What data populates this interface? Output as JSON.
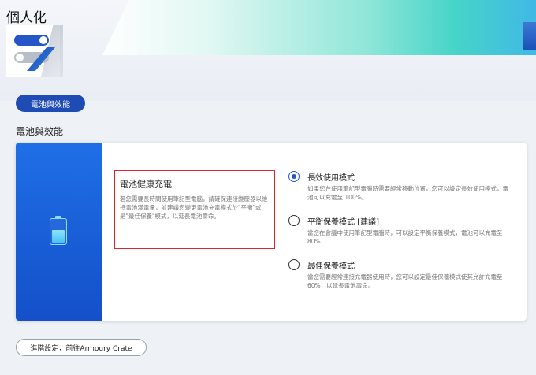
{
  "page": {
    "title": "個人化"
  },
  "hero": {
    "chip_label": "電池與效能"
  },
  "section": {
    "title": "電池與效能"
  },
  "card": {
    "info": {
      "title": "電池健康充電",
      "body": "若您需要長時間使用筆記型電腦，請確保連接變壓器以維持電池滿電量，並建議您變更電池充電模式於\"平衡\"或是\"最佳保養\"模式，以延長電池壽命。"
    },
    "options": [
      {
        "title": "長效使用模式",
        "desc": "如果您在使用筆記型電腦時需要經常移動位置，您可以設定長效使用模式，電池可以充電至 100%。",
        "checked": true
      },
      {
        "title": "平衡保養模式 [建議]",
        "desc": "當您在會議中使用筆記型電腦時，可以設定平衡保養模式，電池可以充電至 80%",
        "checked": false
      },
      {
        "title": "最佳保養模式",
        "desc": "當您需要經常連接充電器使用時，您可以設定最佳保養模式使其允許充電至60%，以延長電池壽命。",
        "checked": false
      }
    ]
  },
  "footer": {
    "button_label": "進階設定，前往Armoury Crate"
  },
  "colors": {
    "accent": "#2456c8",
    "highlight_border": "#d8262c",
    "side_panel": "#1f6fe6"
  },
  "icons": {
    "battery": "battery-icon",
    "toggle_art": "toggle-illustration"
  }
}
